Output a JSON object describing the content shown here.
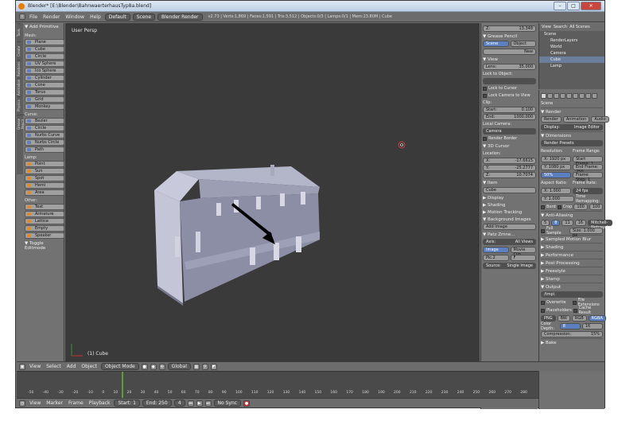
{
  "window": {
    "title": "Blender* [E:\\Blender\\BahnwaerterhausTyp8a.blend]",
    "buttons": [
      "–",
      "□",
      "✕"
    ]
  },
  "header": {
    "menus": [
      "File",
      "Render",
      "Window",
      "Help"
    ],
    "layout": "Default",
    "scene": "Scene",
    "engine": "Blender Render",
    "info": "v2.73 | Verts:1,869 | Faces:1,591 | Tris:3,512 | Objects:0/3 | Lamps:0/1 | Mem:23.80M | Cube"
  },
  "tools": {
    "tabs": [
      "Tools",
      "Create",
      "Relations",
      "Animation",
      "Physics",
      "Grease Pencil"
    ],
    "panel": "▼ Add Primitive",
    "sections": [
      {
        "title": "Mesh:",
        "items": [
          "Plane",
          "Cube",
          "Circle",
          "UV Sphere",
          "Ico Sphere",
          "Cylinder",
          "Cone",
          "Torus"
        ]
      },
      {
        "title": "",
        "items": [
          "Grid",
          "Monkey"
        ]
      },
      {
        "title": "Curve:",
        "items": [
          "Bezier",
          "Circle"
        ]
      },
      {
        "title": "",
        "items": [
          "Nurbs Curve",
          "Nurbs Circle",
          "Path"
        ]
      },
      {
        "title": "Lamp:",
        "items": [
          "Point",
          "Sun",
          "Spot",
          "Hemi",
          "Area"
        ]
      },
      {
        "title": "Other:",
        "items": [
          "Text",
          "Armature",
          "Lattice",
          "Empty",
          "Speaker"
        ]
      }
    ],
    "toggle": "▼ Toggle Editmode"
  },
  "viewport": {
    "label": "User Persp",
    "object": "(1) Cube"
  },
  "props": {
    "top_value": "13.348",
    "grease": "▼ Grease Pencil",
    "scene_btn": "Scene",
    "object_btn": "Object",
    "new": "New",
    "view": "▼ View",
    "lens_label": "Lens:",
    "lens": "35.000",
    "lock": "Lock to Object:",
    "lock_cursor": "Lock to Cursor",
    "lock_camera": "Lock Camera to View",
    "clip": "Clip:",
    "start_label": "Start:",
    "start": "0.100",
    "end_label": "End:",
    "end": "1000.000",
    "local_camera": "Local Camera:",
    "camera": "Camera",
    "render_border": "Render Border",
    "cursor3d": "▼ 3D Cursor",
    "location": "Location:",
    "loc": [
      {
        "a": "X:",
        "v": "-17.6615"
      },
      {
        "a": "Y:",
        "v": "-25.2777"
      },
      {
        "a": "Z:",
        "v": "10.7074"
      }
    ],
    "item": "▼ Item",
    "item_name": "Cube",
    "collapsed": [
      "▶ Display",
      "▶ Shading",
      "▶ Motion Tracking"
    ],
    "bg": "▼ Background Images",
    "add_image": "Add Image",
    "patch": "▼ Patz Zmne...",
    "axis_label": "Axis:",
    "axis": "All Views",
    "image_btn": "Image",
    "movie_btn": "Movie Clip",
    "pic": "Pic.2",
    "frame": "F",
    "source_label": "Source:",
    "source": "Single Image"
  },
  "outliner": {
    "tabs": [
      "View",
      "Search",
      "All Scenes"
    ],
    "rows": [
      "Scene",
      "RenderLayers",
      "World",
      "Camera",
      "Cube",
      "Lamp"
    ]
  },
  "pedit": {
    "scene": "Scene",
    "render": "▼ Render",
    "buttons": [
      "Render",
      "Animation",
      "Audio"
    ],
    "display_label": "Display:",
    "display": "Image Editor",
    "dimensions": "▼ Dimensions",
    "presets": "Render Presets",
    "res_label": "Resolution:",
    "frange_label": "Frame Range:",
    "resx": "X: 1920 px",
    "resy": "Y: 1080 px",
    "pct": "50%",
    "fstart": "Start Frame: 1",
    "fend": "End Frame: 250",
    "fstep": "Frame Step: 1",
    "aspect_label": "Aspect Ratio:",
    "fr_label": "Frame Rate:",
    "ax": "X: 1.000",
    "ay": "Y: 1.000",
    "fps": "24 fps",
    "remap": "Time Remapping:",
    "border": "Bord",
    "crop": "Crop",
    "old": "100",
    "new": "100",
    "aa": "▼ Anti-Aliasing",
    "samples": [
      "5",
      "8",
      "11",
      "16"
    ],
    "filter": "Mitchell-Netravali",
    "full": "Full Sample",
    "size": "Size: 1.000 px",
    "list": [
      "▶ Sampled Motion Blur",
      "▶ Shading",
      "▶ Performance",
      "▶ Post Processing",
      "▶ Freestyle",
      "▶ Stamp"
    ],
    "output": "▼ Output",
    "path": "/tmp\\",
    "overwrite": "Overwrite",
    "ext": "File Extensions",
    "placeholders": "Placeholders",
    "cache": "Cache Result",
    "format": "PNG",
    "bw": "BW",
    "rgb": "RGB",
    "rgba": "RGBA",
    "depth_label": "Color Depth:",
    "d8": "8",
    "d16": "16",
    "comp": "Compression:",
    "compv": "15%",
    "bake": "▶ Bake"
  },
  "viewheader": {
    "menus": [
      "View",
      "Select",
      "Add",
      "Object"
    ],
    "mode": "Object Mode",
    "orient": "Global"
  },
  "timeline": {
    "ticks": [
      "-50",
      "-40",
      "-30",
      "-20",
      "-10",
      "0",
      "10",
      "20",
      "30",
      "40",
      "50",
      "60",
      "70",
      "80",
      "90",
      "100",
      "110",
      "120",
      "130",
      "140",
      "150",
      "160",
      "170",
      "180",
      "190",
      "200",
      "210",
      "220",
      "230",
      "240",
      "250",
      "260",
      "270",
      "280"
    ],
    "menus": [
      "View",
      "Marker",
      "Frame",
      "Playback"
    ],
    "start": "Start: 1",
    "end": "End: 250",
    "current": "4",
    "sync": "No Sync"
  }
}
